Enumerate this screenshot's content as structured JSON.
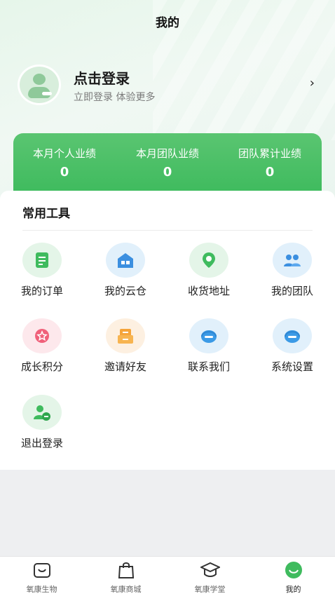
{
  "header": {
    "title": "我的"
  },
  "profile": {
    "login_label": "点击登录",
    "login_sub": "立即登录 体验更多",
    "arrow": "›"
  },
  "stats": [
    {
      "label": "本月个人业绩",
      "value": "0"
    },
    {
      "label": "本月团队业绩",
      "value": "0"
    },
    {
      "label": "团队累计业绩",
      "value": "0"
    }
  ],
  "tools": {
    "title": "常用工具",
    "items": [
      {
        "label": "我的订单",
        "icon": "order-icon"
      },
      {
        "label": "我的云仓",
        "icon": "warehouse-icon"
      },
      {
        "label": "收货地址",
        "icon": "location-icon"
      },
      {
        "label": "我的团队",
        "icon": "team-icon"
      },
      {
        "label": "成长积分",
        "icon": "star-points-icon"
      },
      {
        "label": "邀请好友",
        "icon": "invite-icon"
      },
      {
        "label": "联系我们",
        "icon": "headset-icon"
      },
      {
        "label": "系统设置",
        "icon": "settings-icon"
      },
      {
        "label": "退出登录",
        "icon": "logout-icon"
      }
    ]
  },
  "tabbar": {
    "items": [
      {
        "label": "氧康生物",
        "icon": "bag-home-icon"
      },
      {
        "label": "氧康商城",
        "icon": "shopping-bag-icon"
      },
      {
        "label": "氧康学堂",
        "icon": "graduation-cap-icon"
      },
      {
        "label": "我的",
        "icon": "smile-face-icon",
        "active": true
      }
    ]
  },
  "colors": {
    "accent": "#3fbb5e",
    "accent_light": "#e4f5e8",
    "blue_light": "#e1f0fb"
  }
}
